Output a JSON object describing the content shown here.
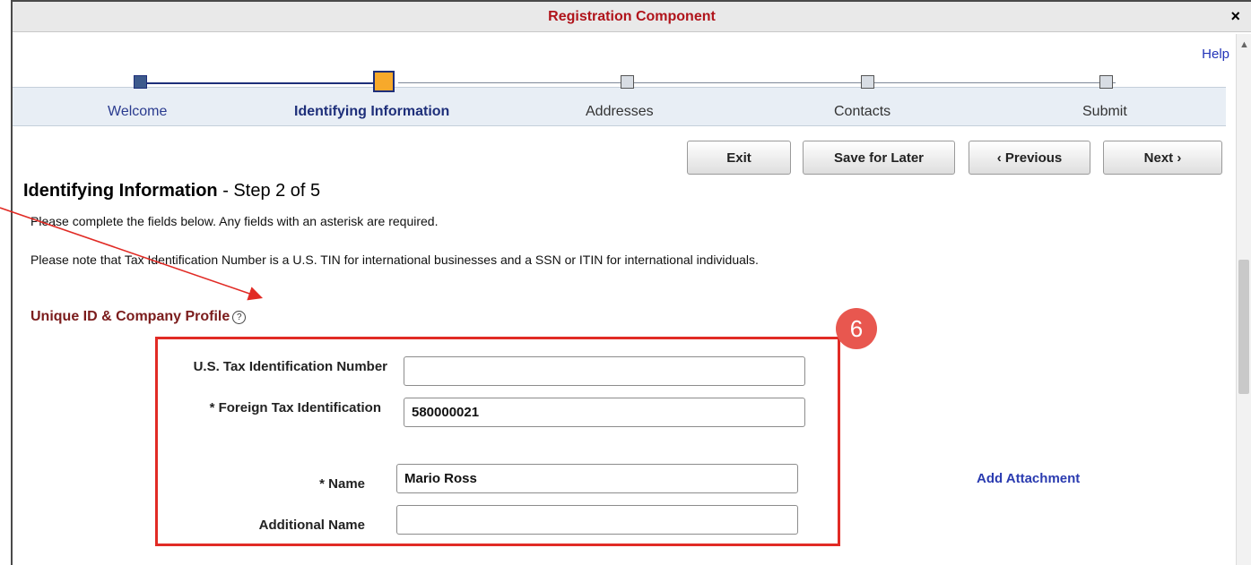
{
  "window": {
    "title": "Registration Component",
    "close_glyph": "×",
    "help_label": "Help"
  },
  "steps": [
    {
      "label": "Welcome",
      "state": "done"
    },
    {
      "label": "Identifying Information",
      "state": "current"
    },
    {
      "label": "Addresses",
      "state": "pending"
    },
    {
      "label": "Contacts",
      "state": "pending"
    },
    {
      "label": "Submit",
      "state": "pending"
    }
  ],
  "toolbar": {
    "exit": "Exit",
    "save_for_later": "Save for Later",
    "previous": "‹ Previous",
    "next": "Next ›"
  },
  "page": {
    "title_bold": "Identifying Information",
    "title_rest": " - Step 2 of 5",
    "instruction_1": "Please complete the fields below.  Any fields with an asterisk are required.",
    "instruction_2": "Please note that Tax Identification Number is a U.S. TIN for international businesses and a SSN or ITIN for international individuals."
  },
  "section": {
    "title": "Unique ID & Company Profile",
    "help_glyph": "?"
  },
  "annotation": {
    "badge": "6",
    "colors": {
      "box": "#e12b25",
      "badge": "#e8574f"
    }
  },
  "form": {
    "us_tin": {
      "label": "U.S. Tax Identification Number",
      "value": ""
    },
    "foreign_tin": {
      "label": "* Foreign Tax Identification",
      "value": "580000021"
    },
    "name": {
      "label": "* Name",
      "value": "Mario Ross"
    },
    "additional_name": {
      "label": "Additional Name",
      "value": ""
    }
  },
  "add_attachment": "Add Attachment",
  "colors": {
    "title_red": "#b0141b",
    "link_blue": "#2a3bb0",
    "current_step": "#f7a92b"
  }
}
